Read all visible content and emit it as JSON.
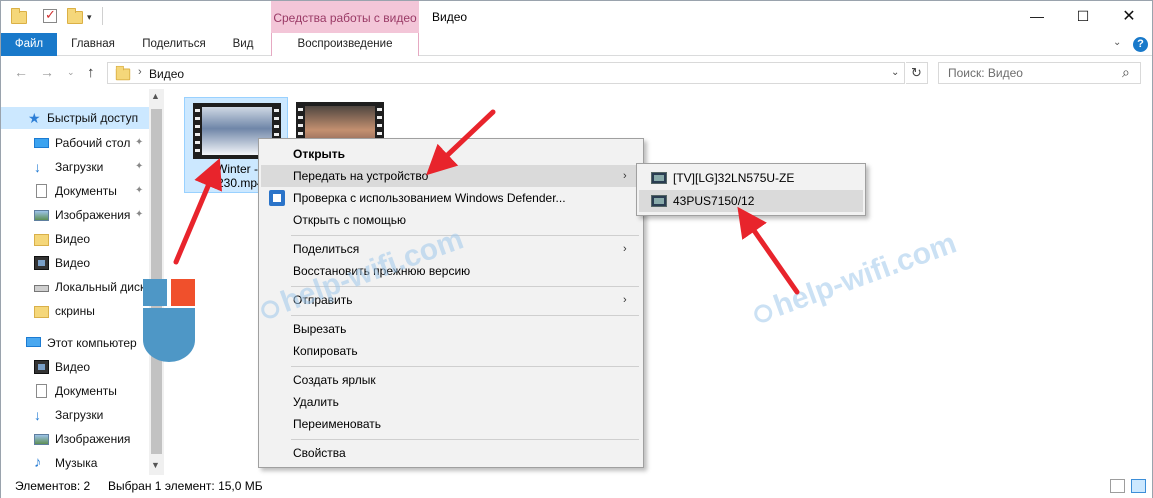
{
  "window": {
    "title": "Видео",
    "context_tab_group": "Средства работы с видео"
  },
  "ribbon": {
    "tabs": [
      "Файл",
      "Главная",
      "Поделиться",
      "Вид",
      "Воспроизведение"
    ],
    "active_tab": "Файл"
  },
  "address": {
    "crumb": "Видео",
    "search_placeholder": "Поиск: Видео"
  },
  "sidebar": {
    "items": [
      {
        "label": "Быстрый доступ",
        "icon": "star-icon",
        "pinned": false
      },
      {
        "label": "Рабочий стол",
        "icon": "desktop-icon",
        "pinned": true
      },
      {
        "label": "Загрузки",
        "icon": "download-icon",
        "pinned": true
      },
      {
        "label": "Документы",
        "icon": "document-icon",
        "pinned": true
      },
      {
        "label": "Изображения",
        "icon": "pictures-icon",
        "pinned": true
      },
      {
        "label": "Видео",
        "icon": "folder-icon",
        "pinned": false
      },
      {
        "label": "Видео",
        "icon": "video-icon",
        "pinned": false
      },
      {
        "label": "Локальный диск",
        "icon": "drive-icon",
        "pinned": false
      },
      {
        "label": "скрины",
        "icon": "folder-icon",
        "pinned": false
      },
      {
        "label": "Этот компьютер",
        "icon": "computer-icon",
        "pinned": false
      },
      {
        "label": "Видео",
        "icon": "video-icon",
        "pinned": false
      },
      {
        "label": "Документы",
        "icon": "document-icon",
        "pinned": false
      },
      {
        "label": "Загрузки",
        "icon": "download-icon",
        "pinned": false
      },
      {
        "label": "Изображения",
        "icon": "pictures-icon",
        "pinned": false
      },
      {
        "label": "Музыка",
        "icon": "music-icon",
        "pinned": false
      }
    ]
  },
  "files": [
    {
      "name_line1": "Winter -",
      "name_line2": "4230.mp4",
      "selected": true
    },
    {
      "name_line1": "",
      "name_line2": "",
      "selected": false
    }
  ],
  "context_menu": {
    "items": [
      {
        "label": "Открыть",
        "bold": true
      },
      {
        "label": "Передать на устройство",
        "submenu": true,
        "highlighted": true
      },
      {
        "label": "Проверка с использованием Windows Defender...",
        "icon": "shield-icon"
      },
      {
        "label": "Открыть с помощью",
        "submenu": true
      },
      {
        "label": "Поделиться",
        "submenu": true
      },
      {
        "label": "Восстановить прежнюю версию"
      },
      {
        "label": "Отправить",
        "submenu": true
      },
      {
        "label": "Вырезать"
      },
      {
        "label": "Копировать"
      },
      {
        "label": "Создать ярлык"
      },
      {
        "label": "Удалить"
      },
      {
        "label": "Переименовать"
      },
      {
        "label": "Свойства"
      }
    ]
  },
  "submenu": {
    "items": [
      {
        "label": "[TV][LG]32LN575U-ZE",
        "icon": "tv-icon"
      },
      {
        "label": "43PUS7150/12",
        "icon": "tv-icon",
        "highlighted": true
      }
    ]
  },
  "watermark": "help-wifi.com",
  "status": {
    "count": "Элементов: 2",
    "selection": "Выбран 1 элемент: 15,0 МБ"
  },
  "colors": {
    "accent": "#1979ca",
    "context_tab": "#f3c6d8",
    "selection": "#cce8ff",
    "arrow": "#e8242c"
  }
}
